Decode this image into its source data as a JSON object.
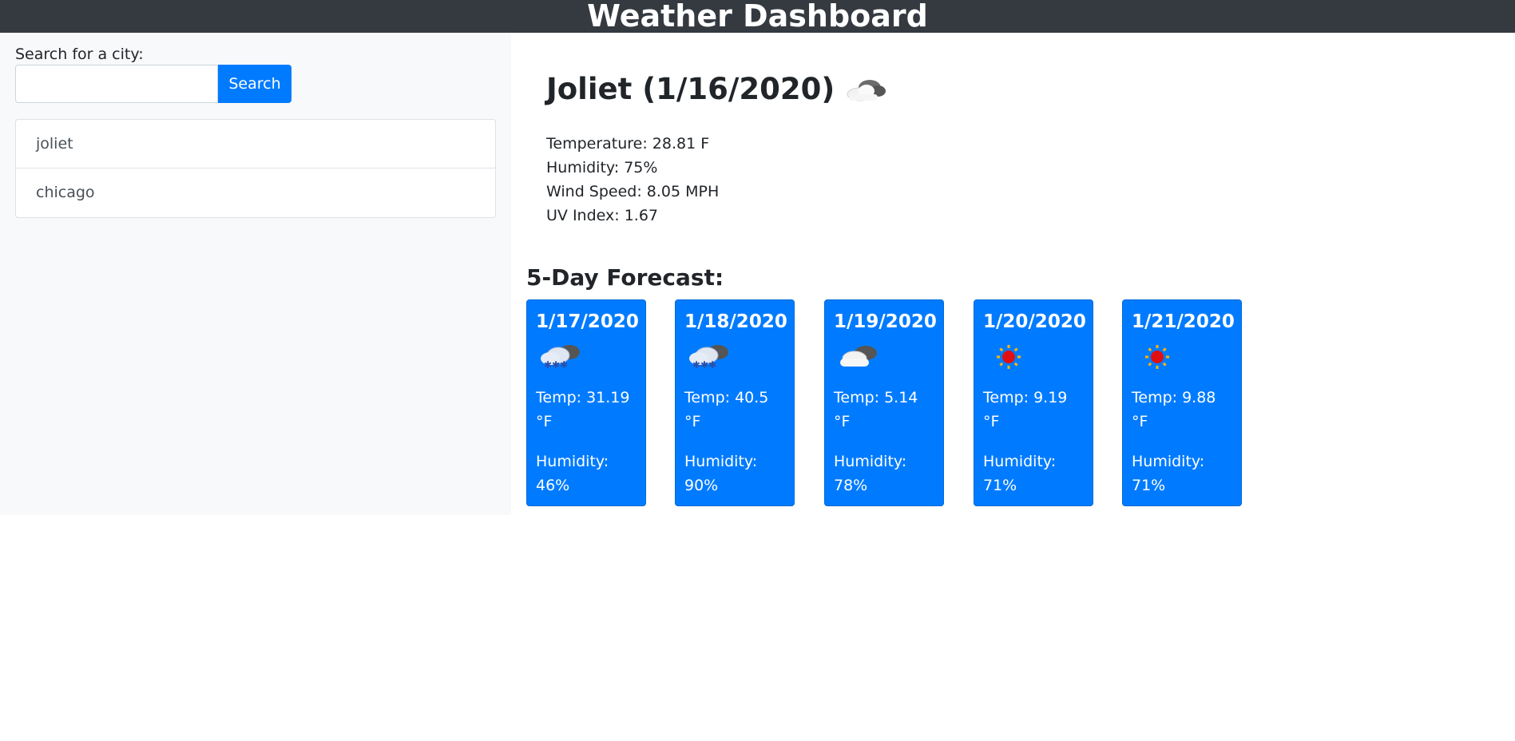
{
  "header": {
    "title": "Weather Dashboard"
  },
  "search": {
    "label": "Search for a city:",
    "input_value": "",
    "button_label": "Search"
  },
  "history": [
    {
      "label": "joliet"
    },
    {
      "label": "chicago"
    }
  ],
  "current": {
    "title": "Joliet (1/16/2020)",
    "icon": "cloud-icon",
    "temperature": "Temperature: 28.81 F",
    "humidity": "Humidity: 75%",
    "wind": "Wind Speed: 8.05 MPH",
    "uv": "UV Index: 1.67"
  },
  "forecast": {
    "title": "5-Day Forecast:",
    "days": [
      {
        "date": "1/17/2020",
        "icon": "snow-cloud-icon",
        "temp": "Temp: 31.19 °F",
        "humidity": "Humidity: 46%"
      },
      {
        "date": "1/18/2020",
        "icon": "snow-cloud-icon",
        "temp": "Temp: 40.5 °F",
        "humidity": "Humidity: 90%"
      },
      {
        "date": "1/19/2020",
        "icon": "cloud-icon",
        "temp": "Temp: 5.14 °F",
        "humidity": "Humidity: 78%"
      },
      {
        "date": "1/20/2020",
        "icon": "sun-icon",
        "temp": "Temp: 9.19 °F",
        "humidity": "Humidity: 71%"
      },
      {
        "date": "1/21/2020",
        "icon": "sun-icon",
        "temp": "Temp: 9.88 °F",
        "humidity": "Humidity: 71%"
      }
    ]
  },
  "colors": {
    "header_bg": "#343a40",
    "accent": "#007bff",
    "sidebar_bg": "#f8f9fa"
  }
}
